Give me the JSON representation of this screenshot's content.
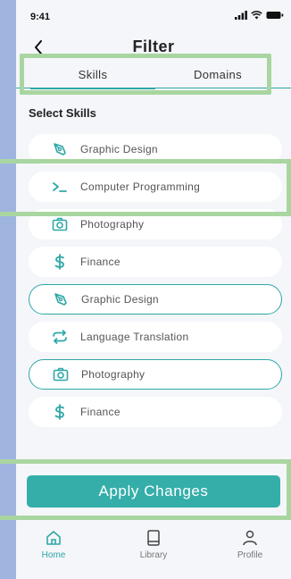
{
  "status_bar": {
    "time": "9:41"
  },
  "header": {
    "title": "Filter"
  },
  "tabs": [
    {
      "label": "Skills",
      "active": true
    },
    {
      "label": "Domains",
      "active": false
    }
  ],
  "section": {
    "title": "Select Skills"
  },
  "skills": [
    {
      "label": "Graphic Design",
      "icon": "pen-tool-icon",
      "selected": false
    },
    {
      "label": "Computer Programming",
      "icon": "terminal-icon",
      "selected": true
    },
    {
      "label": "Photography",
      "icon": "camera-icon",
      "selected": false
    },
    {
      "label": "Finance",
      "icon": "dollar-icon",
      "selected": false
    },
    {
      "label": "Graphic Design",
      "icon": "pen-tool-icon",
      "selected": true
    },
    {
      "label": "Language Translation",
      "icon": "repeat-icon",
      "selected": false
    },
    {
      "label": "Photography",
      "icon": "camera-icon",
      "selected": true
    },
    {
      "label": "Finance",
      "icon": "dollar-icon",
      "selected": false
    }
  ],
  "apply_button": {
    "label": "Apply Changes"
  },
  "tab_bar": [
    {
      "label": "Home",
      "icon": "home-icon",
      "active": true
    },
    {
      "label": "Library",
      "icon": "book-icon",
      "active": false
    },
    {
      "label": "Profile",
      "icon": "user-icon",
      "active": false
    }
  ],
  "colors": {
    "accent": "#2fa7a7",
    "button": "#35aeaa",
    "highlight": "#a9d6a0",
    "background": "#f4f6fa"
  }
}
